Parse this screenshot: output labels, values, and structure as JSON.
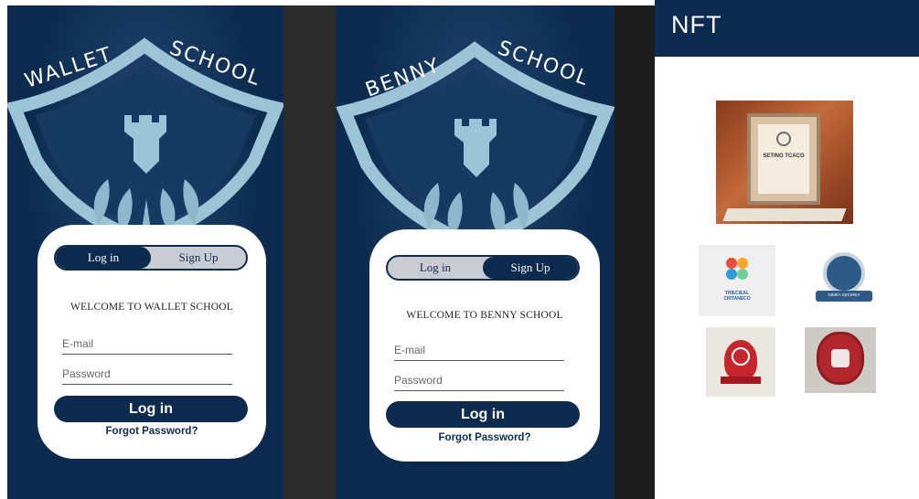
{
  "screens": [
    {
      "crest_word_left": "WALLET",
      "crest_word_right": "SCHOOL",
      "toggle": {
        "left": "Log in",
        "right": "Sign Up",
        "active": "left"
      },
      "welcome": "WELCOME  TO WALLET SCHOOL",
      "email_placeholder": "E-mail",
      "password_placeholder": "Password",
      "login_label": "Log in",
      "forgot_label": "Forgot Password?"
    },
    {
      "crest_word_left": "BENNY",
      "crest_word_right": "SCHOOL",
      "toggle": {
        "left": "Log in",
        "right": "Sign Up",
        "active": "right"
      },
      "welcome": "WELCOME  TO BENNY SCHOOL",
      "email_placeholder": "E-mail",
      "password_placeholder": "Password",
      "login_label": "Log in",
      "forgot_label": "Forgot Password?"
    }
  ],
  "nft": {
    "title": "NFT",
    "featured_caption": "SETINO TCACO",
    "badge_a_caption": "TRIECIEAL\nCIRTANECO",
    "badge_b_caption": "NIMEA SECIREA"
  },
  "colors": {
    "navy": "#0c2b4f",
    "crest": "#9cc3d6",
    "card": "#ffffff",
    "toggle_inactive": "#c9ccd1"
  },
  "icons": [
    "shield-crest-icon",
    "tower-icon",
    "leaf-icon"
  ]
}
